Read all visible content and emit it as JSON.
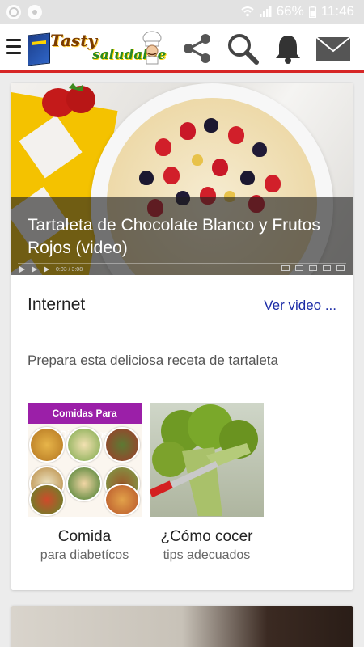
{
  "status_bar": {
    "battery": "66%",
    "time": "11:46"
  },
  "app_bar": {
    "logo_title": "Tasty",
    "logo_subtitle": "saludable",
    "actions": [
      "share-icon",
      "search-icon",
      "bell-icon",
      "mail-icon"
    ]
  },
  "colors": {
    "accent_line": "#d62626",
    "link": "#1a2aa6",
    "banner": "#9b1fa8"
  },
  "feed": {
    "cards": [
      {
        "title": "Tartaleta de Chocolate Blanco y Frutos Rojos (video)",
        "video_time": "0:03 / 3:08",
        "source": "Internet",
        "cta": "Ver video ...",
        "description": "Prepara esta deliciosa receta de tartaleta",
        "related": [
          {
            "banner": "Comidas Para Diabéticos",
            "name": "Comida",
            "sub": "para diabetícos"
          },
          {
            "name": "¿Cómo cocer",
            "sub": "tips adecuados"
          }
        ]
      }
    ]
  }
}
